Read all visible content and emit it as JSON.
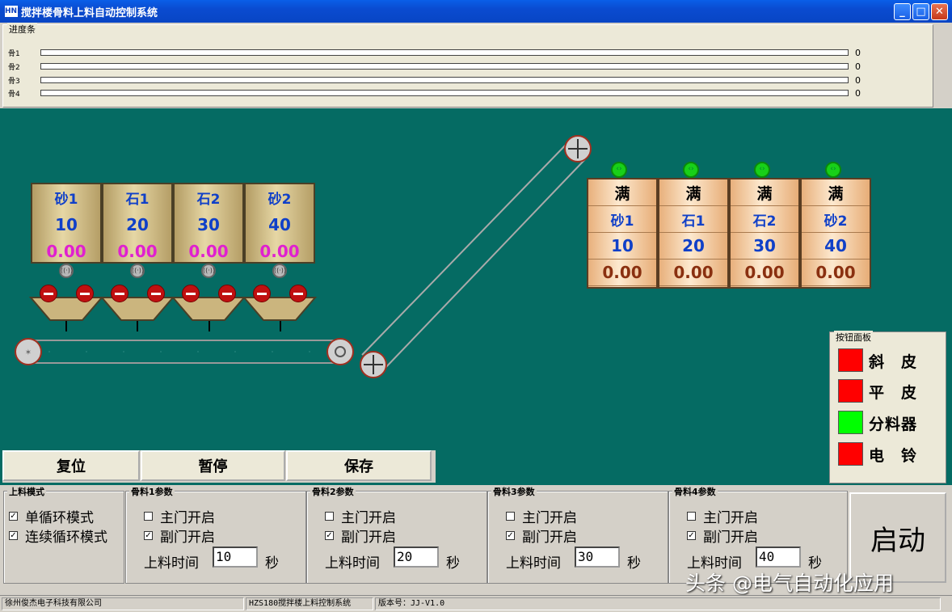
{
  "window": {
    "title": "搅拌楼骨料上料自动控制系统",
    "app_icon": "HNB"
  },
  "progress": {
    "legend": "进度条",
    "rows": [
      {
        "label": "骨1",
        "value": "0"
      },
      {
        "label": "骨2",
        "value": "0"
      },
      {
        "label": "骨3",
        "value": "0"
      },
      {
        "label": "骨4",
        "value": "0"
      }
    ]
  },
  "silos": [
    {
      "name": "砂1",
      "target": "10",
      "actual": "0.00"
    },
    {
      "name": "石1",
      "target": "20",
      "actual": "0.00"
    },
    {
      "name": "石2",
      "target": "30",
      "actual": "0.00"
    },
    {
      "name": "砂2",
      "target": "40",
      "actual": "0.00"
    }
  ],
  "bins": [
    {
      "full": "满",
      "name": "砂1",
      "target": "10",
      "actual": "0.00"
    },
    {
      "full": "满",
      "name": "石1",
      "target": "20",
      "actual": "0.00"
    },
    {
      "full": "满",
      "name": "石2",
      "target": "30",
      "actual": "0.00"
    },
    {
      "full": "满",
      "name": "砂2",
      "target": "40",
      "actual": "0.00"
    }
  ],
  "controls": {
    "reset": "复位",
    "pause": "暂停",
    "save": "保存"
  },
  "button_panel": {
    "legend": "按钮面板",
    "items": [
      {
        "label": "斜　皮",
        "color": "#ff0000"
      },
      {
        "label": "平　皮",
        "color": "#ff0000"
      },
      {
        "label": "分料器",
        "color": "#00ff00"
      },
      {
        "label": "电　铃",
        "color": "#ff0000"
      }
    ]
  },
  "mode": {
    "title": "上料模式",
    "single": "单循环模式",
    "continuous": "连续循环模式",
    "single_checked": true,
    "continuous_checked": true
  },
  "params": [
    {
      "title": "骨料1参数",
      "main_gate": "主门开启",
      "sub_gate": "副门开启",
      "time_label": "上料时间",
      "time": "10",
      "unit": "秒"
    },
    {
      "title": "骨料2参数",
      "main_gate": "主门开启",
      "sub_gate": "副门开启",
      "time_label": "上料时间",
      "time": "20",
      "unit": "秒"
    },
    {
      "title": "骨料3参数",
      "main_gate": "主门开启",
      "sub_gate": "副门开启",
      "time_label": "上料时间",
      "time": "30",
      "unit": "秒"
    },
    {
      "title": "骨料4参数",
      "main_gate": "主门开启",
      "sub_gate": "副门开启",
      "time_label": "上料时间",
      "time": "40",
      "unit": "秒"
    }
  ],
  "start": "启动",
  "status": {
    "company": "徐州俊杰电子科技有限公司",
    "system": "HZS180搅拌楼上料控制系统",
    "version": "版本号：JJ-V1.0"
  },
  "watermark": "头条 @电气自动化应用"
}
